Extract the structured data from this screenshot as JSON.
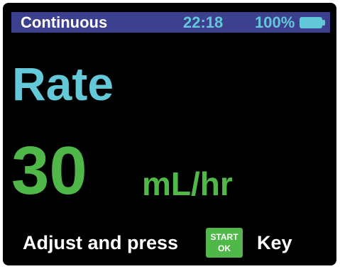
{
  "status_bar": {
    "mode": "Continuous",
    "time": "22:18",
    "battery_percent": "100%",
    "battery_icon": "battery-full-icon",
    "background_color": "#3d3f8f"
  },
  "main": {
    "parameter_title": "Rate",
    "value": "30",
    "unit": "mL/hr"
  },
  "instruction": {
    "prefix": "Adjust and press",
    "key_label_line1": "START",
    "key_label_line2": "OK",
    "suffix": "Key"
  },
  "colors": {
    "title": "#63c8d8",
    "value": "#4fb848",
    "key": "#4fb848",
    "screen_background": "#000000"
  }
}
